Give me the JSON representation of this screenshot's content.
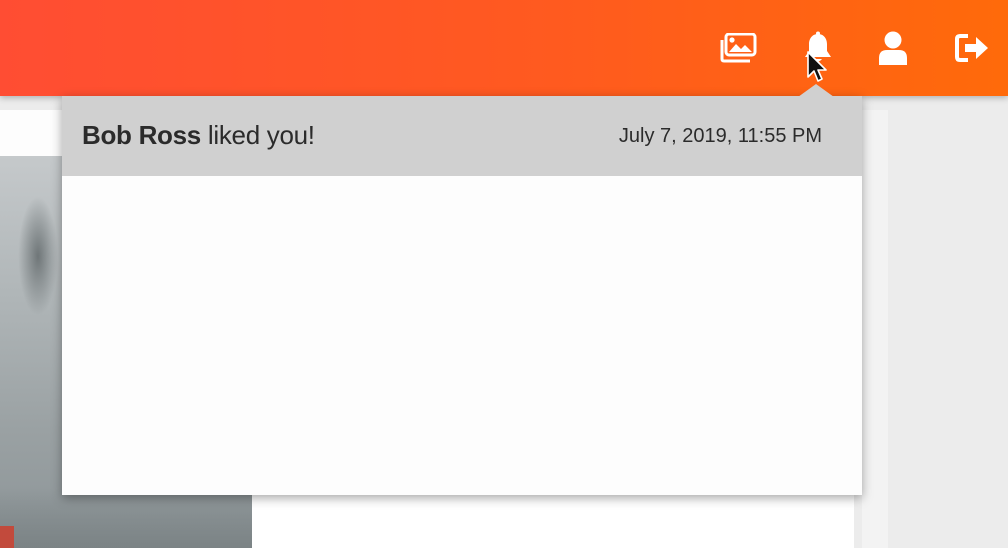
{
  "header": {
    "nav": [
      {
        "icon": "gallery-icon"
      },
      {
        "icon": "bell-icon"
      },
      {
        "icon": "user-icon"
      },
      {
        "icon": "logout-icon"
      }
    ],
    "icon_color": "#ffffff"
  },
  "notifications": {
    "items": [
      {
        "sender": "Bob Ross",
        "message": "liked you!",
        "timestamp": "July 7, 2019, 11:55 PM"
      }
    ]
  },
  "colors": {
    "header_start": "#ff4d33",
    "header_end": "#ff6a0a",
    "notification_bg": "#d0d0d0",
    "dropdown_bg": "#fdfdfd",
    "text": "#2b2b2b"
  }
}
